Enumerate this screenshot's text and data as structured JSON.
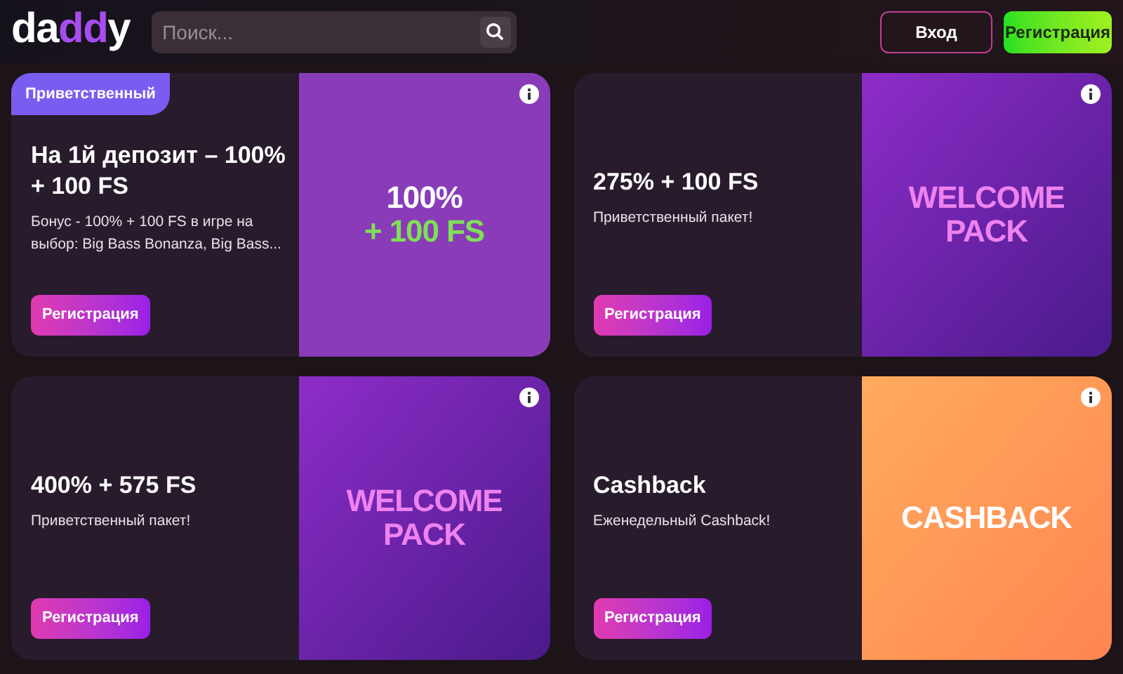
{
  "header": {
    "logo": [
      {
        "text": "da",
        "accent": false
      },
      {
        "text": "dd",
        "accent": true
      },
      {
        "text": "y",
        "accent": false
      }
    ],
    "search": {
      "placeholder": "Поиск..."
    },
    "buttons": [
      {
        "label": "Вход",
        "kind": "outline"
      },
      {
        "label": "Регистрация",
        "kind": "primary"
      }
    ]
  },
  "promos": [
    {
      "badge": "Приветственный",
      "title": "На 1й депозит – 100% + 100 FS",
      "description": "Бонус - 100% + 100 FS в игре на выбор: Big Bass Bonanza, Big Bass...",
      "button": "Регистрация",
      "banner": {
        "kind": "purple",
        "lines": [
          {
            "text": "100%",
            "color": "#ffffff"
          },
          {
            "text": "+ 100 FS",
            "color": "#7ee057"
          }
        ]
      }
    },
    {
      "title": "275% + 100 FS",
      "description": "Приветственный пакет!",
      "button": "Регистрация",
      "banner": {
        "kind": "violet",
        "lines": [
          {
            "text": "WELCOME",
            "color": "#ee82f0"
          },
          {
            "text": "PACK",
            "color": "#ee82f0"
          }
        ]
      }
    },
    {
      "title": "400% + 575 FS",
      "description": "Приветственный пакет!",
      "button": "Регистрация",
      "banner": {
        "kind": "violet",
        "lines": [
          {
            "text": "WELCOME",
            "color": "#ee82f0"
          },
          {
            "text": "PACK",
            "color": "#ee82f0"
          }
        ]
      }
    },
    {
      "title": "Cashback",
      "description": "Еженедельный Cashback!",
      "button": "Регистрация",
      "banner": {
        "kind": "orange",
        "lines": [
          {
            "text": "CASHBACK",
            "color": "#ffffff"
          }
        ]
      }
    }
  ]
}
